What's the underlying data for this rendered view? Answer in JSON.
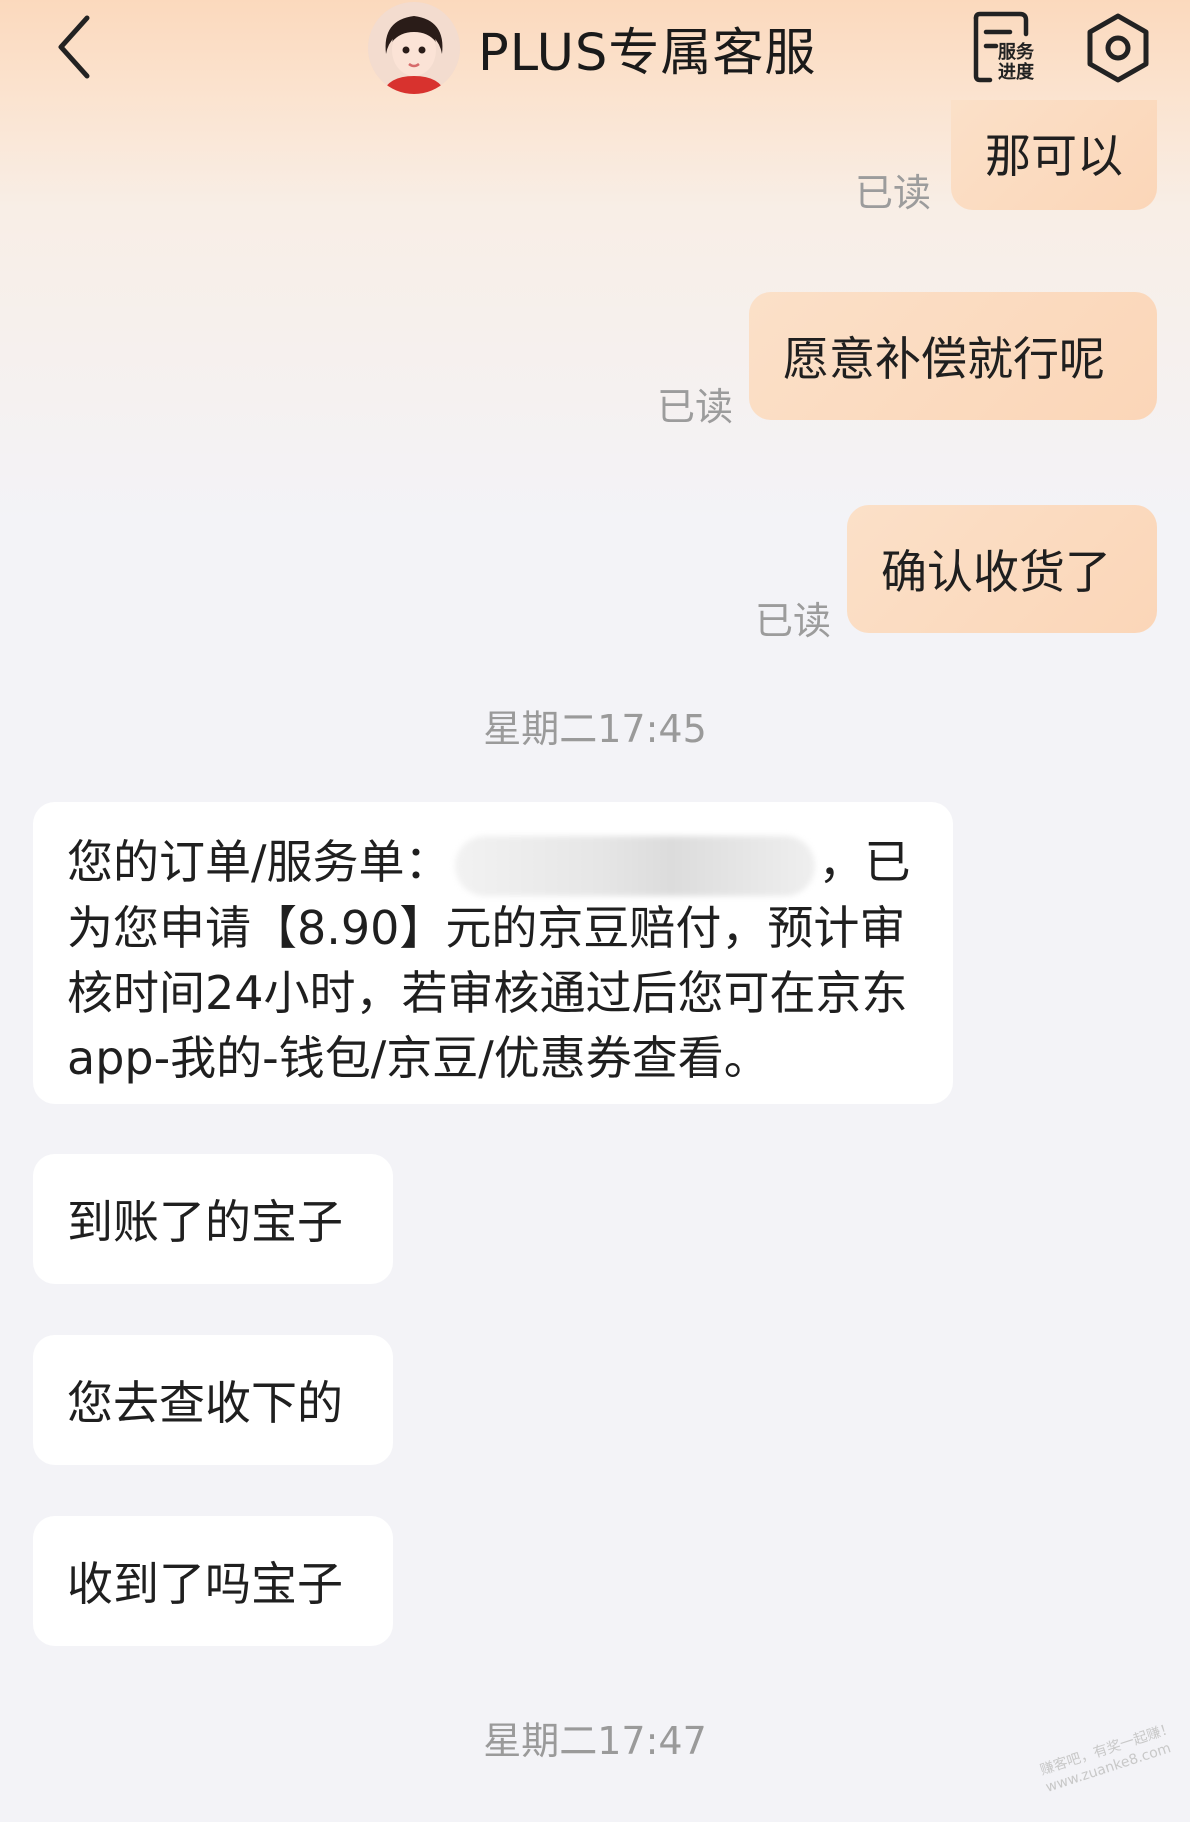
{
  "header": {
    "title": "PLUS专属客服",
    "progress_label_line1": "服务",
    "progress_label_line2": "进度"
  },
  "messages": {
    "out1": {
      "text": "那可以",
      "status": "已读"
    },
    "out2": {
      "text": "愿意补偿就行呢",
      "status": "已读"
    },
    "out3": {
      "text": "确认收货了",
      "status": "已读"
    },
    "time1": "星期二17:45",
    "in1": {
      "prefix": "您的订单/服务单：",
      "after_blur": "，已",
      "rest": "为您申请【8.90】元的京豆赔付，预计审核时间24小时，若审核通过后您可在京东app-我的-钱包/京豆/优惠券查看。"
    },
    "in2": "到账了的宝子",
    "in3": "您去查收下的",
    "in4": "收到了吗宝子",
    "time2": "星期二17:47"
  },
  "watermark": {
    "line1": "赚客吧，有奖一起赚！",
    "line2": "www.zuanke8.com"
  },
  "colors": {
    "outgoing_bubble": "#fbdcc3",
    "incoming_bubble": "#ffffff",
    "background": "#f3f3f7",
    "header_gradient_top": "#fbd9bd",
    "muted_text": "#9c9c9c"
  },
  "icons": {
    "back": "chevron-left-icon",
    "progress": "service-progress-icon",
    "settings": "settings-hexagon-icon",
    "avatar": "agent-avatar"
  }
}
